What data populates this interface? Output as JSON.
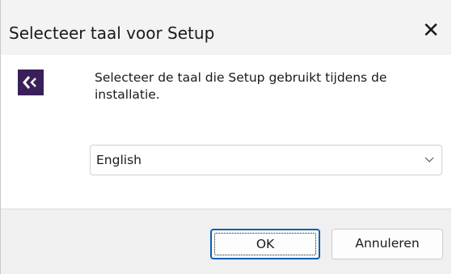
{
  "window": {
    "title": "Selecteer taal voor Setup",
    "close_glyph": "✕"
  },
  "content": {
    "icon": "setup-logo-icon",
    "message": "Selecteer de taal die Setup gebruikt tijdens de installatie.",
    "language_select": {
      "value": "English",
      "chevron": "chevron-down-icon"
    }
  },
  "buttons": {
    "ok_label": "OK",
    "cancel_label": "Annuleren"
  },
  "colors": {
    "icon_background": "#3a1f5a",
    "focus_border": "#0a5fb4"
  }
}
